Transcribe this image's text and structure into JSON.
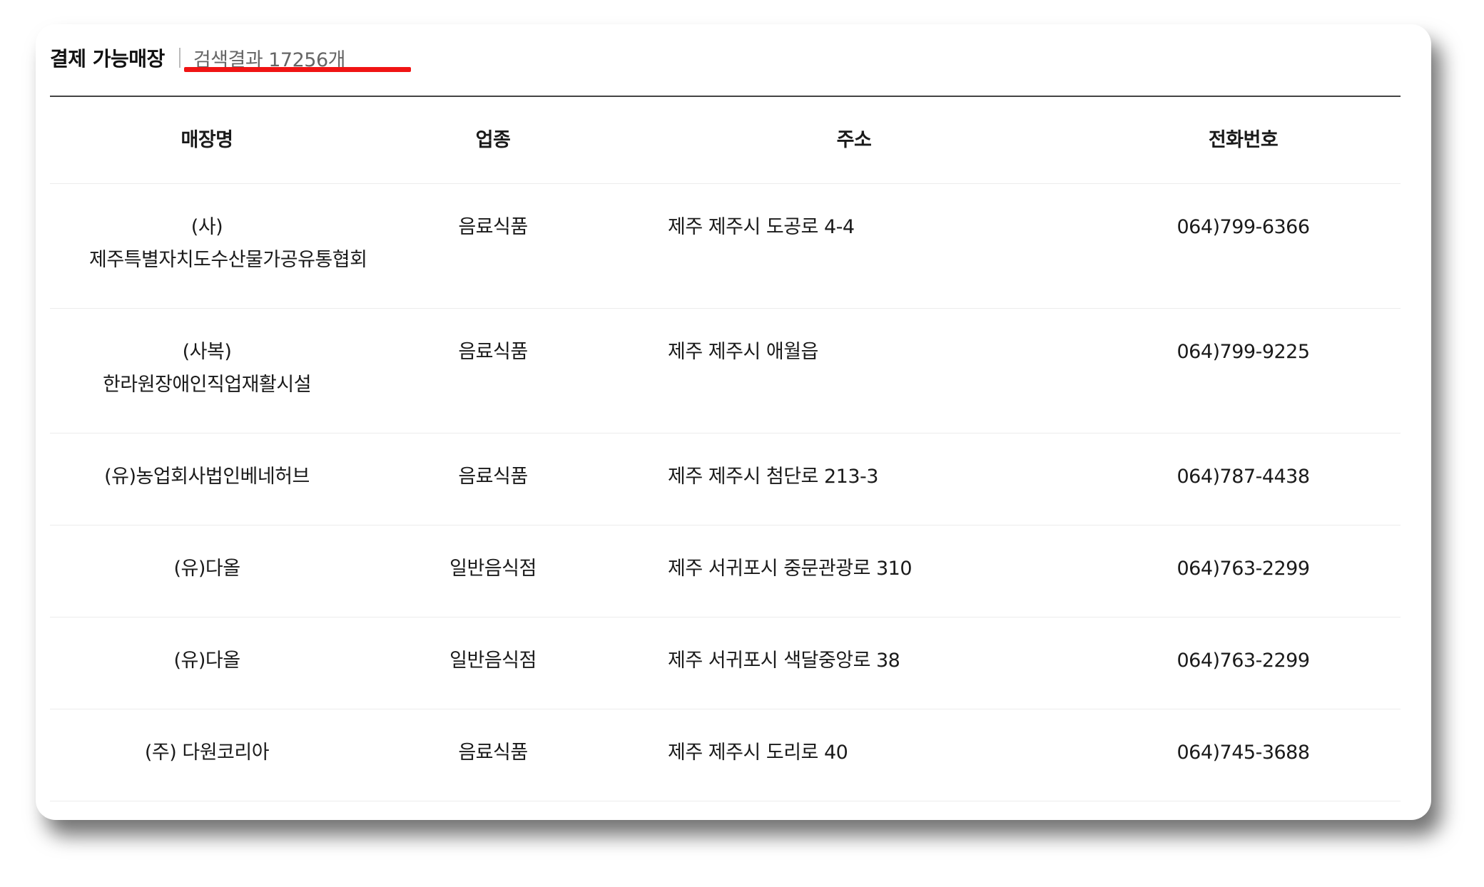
{
  "header": {
    "title": "결제 가능매장",
    "result_count": "검색결과 17256개"
  },
  "accent_color": "#f01414",
  "table": {
    "columns": [
      "매장명",
      "업종",
      "주소",
      "전화번호"
    ],
    "rows": [
      {
        "name": "(사)제주특별자치도수산물가공유통협회",
        "type": "음료식품",
        "address": "제주 제주시 도공로 4-4",
        "phone": "064)799-6366"
      },
      {
        "name": "(사복)한라원장애인직업재활시설",
        "type": "음료식품",
        "address": "제주 제주시 애월읍",
        "phone": "064)799-9225"
      },
      {
        "name": "(유)농업회사법인베네허브",
        "type": "음료식품",
        "address": "제주 제주시 첨단로 213-3",
        "phone": "064)787-4438"
      },
      {
        "name": "(유)다올",
        "type": "일반음식점",
        "address": "제주 서귀포시 중문관광로 310",
        "phone": "064)763-2299"
      },
      {
        "name": "(유)다올",
        "type": "일반음식점",
        "address": "제주 서귀포시 색달중앙로 38",
        "phone": "064)763-2299"
      },
      {
        "name": "(주) 다원코리아",
        "type": "음료식품",
        "address": "제주 제주시 도리로 40",
        "phone": "064)745-3688"
      }
    ]
  }
}
